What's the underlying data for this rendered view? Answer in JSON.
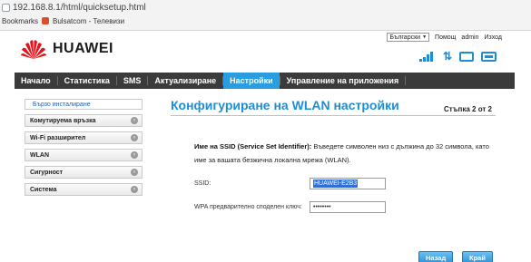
{
  "browser": {
    "url": "192.168.8.1/html/quicksetup.html",
    "bookmarks": [
      "Bookmarks",
      "Bulsatcom - Телевизи"
    ]
  },
  "header": {
    "language": "Български",
    "help": "Помощ",
    "user": "admin",
    "logout": "Изход",
    "logo_text": "HUAWEI"
  },
  "nav": {
    "items": [
      "Начало",
      "Статистика",
      "SMS",
      "Актуализиране",
      "Настройки",
      "Управление на приложения"
    ],
    "active": "Настройки"
  },
  "sidebar": {
    "items": [
      {
        "label": "Бързо инсталиране"
      },
      {
        "label": "Комутируема връзка"
      },
      {
        "label": "Wi-Fi разширител"
      },
      {
        "label": "WLAN"
      },
      {
        "label": "Сигурност"
      },
      {
        "label": "Система"
      }
    ]
  },
  "main": {
    "title": "Конфигуриране на WLAN настройки",
    "step": "Стъпка 2 от 2",
    "desc_bold": "Име на SSID (Service Set Identifier):",
    "desc_text": "Въведете символен низ с дължина до 32 символа, като име за вашата безжична локална мрежа (WLAN).",
    "ssid_label": "SSID:",
    "ssid_value": "HUAWEI-E2B3",
    "wpa_label": "WPA предварително споделен ключ:",
    "wpa_value": "••••••••",
    "back_button": "Назад",
    "finish_button": "Край"
  },
  "colors": {
    "accent": "#1d8ed6",
    "nav_bg": "#3b3b3b",
    "nav_active": "#2a9de0"
  }
}
